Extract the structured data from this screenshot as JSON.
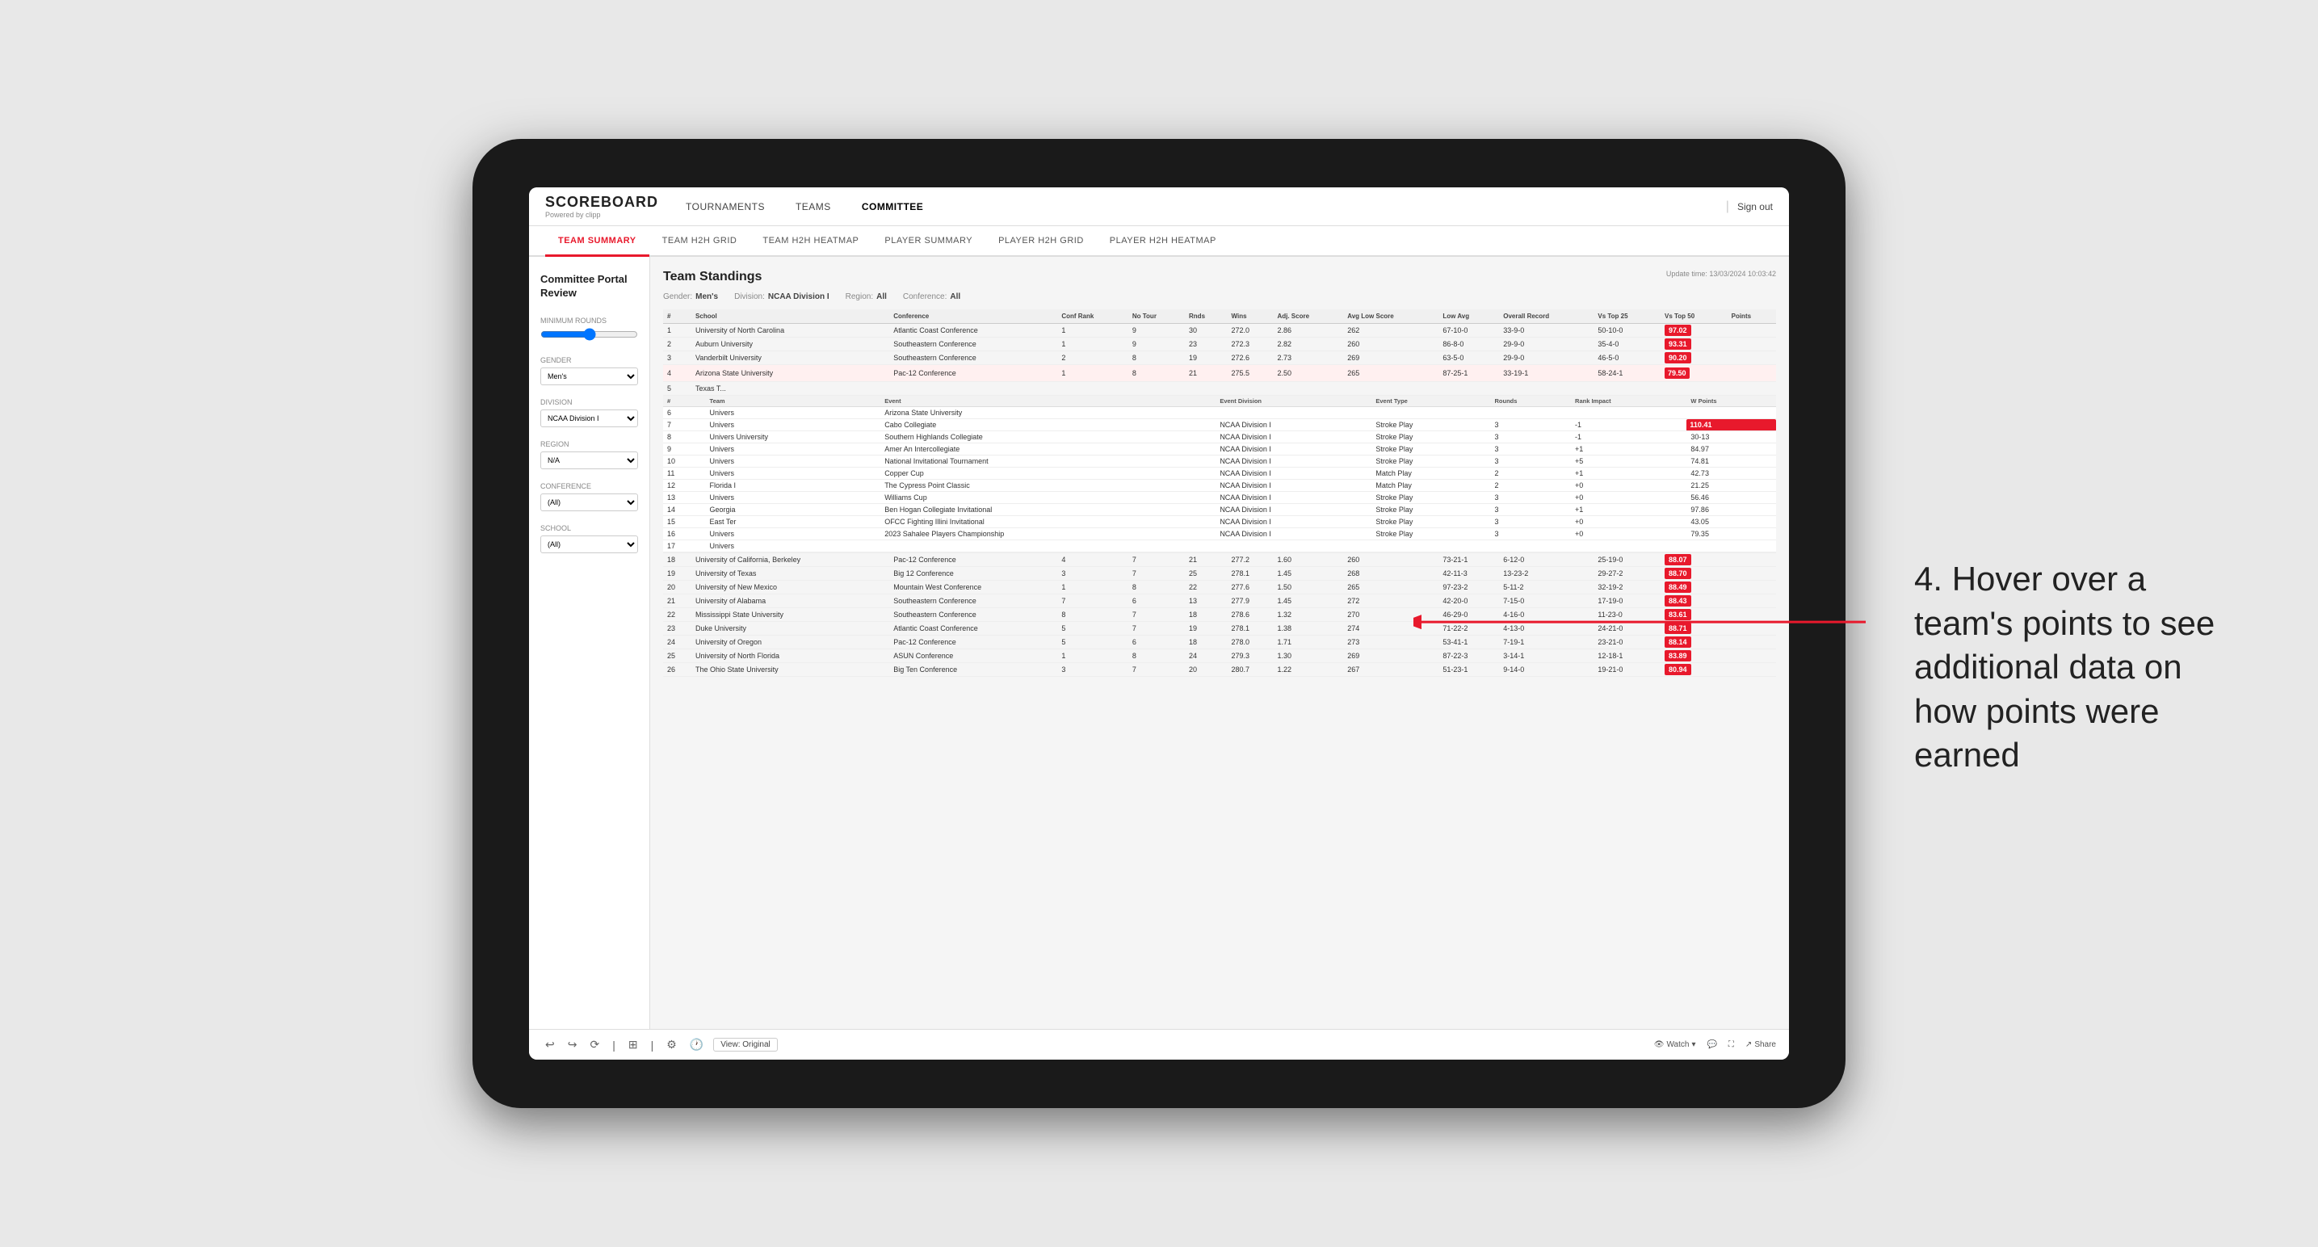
{
  "tablet": {
    "nav": {
      "logo": "SCOREBOARD",
      "powered_by": "Powered by clipp",
      "links": [
        "TOURNAMENTS",
        "TEAMS",
        "COMMITTEE"
      ],
      "sign_out": "Sign out"
    },
    "tabs": [
      {
        "label": "TEAM SUMMARY",
        "active": true
      },
      {
        "label": "TEAM H2H GRID"
      },
      {
        "label": "TEAM H2H HEATMAP"
      },
      {
        "label": "PLAYER SUMMARY"
      },
      {
        "label": "PLAYER H2H GRID"
      },
      {
        "label": "PLAYER H2H HEATMAP"
      }
    ],
    "sidebar": {
      "title": "Committee Portal Review",
      "sections": [
        {
          "label": "Minimum Rounds",
          "type": "range"
        },
        {
          "label": "Gender",
          "type": "select",
          "value": "Men's"
        },
        {
          "label": "Division",
          "type": "select",
          "value": "NCAA Division I"
        },
        {
          "label": "Region",
          "type": "select",
          "value": "N/A"
        },
        {
          "label": "Conference",
          "type": "select",
          "value": "(All)"
        },
        {
          "label": "School",
          "type": "select",
          "value": "(All)"
        }
      ]
    },
    "report": {
      "title": "Team Standings",
      "update_time": "Update time: 13/03/2024 10:03:42",
      "filters": {
        "gender": {
          "label": "Gender:",
          "value": "Men's"
        },
        "division": {
          "label": "Division:",
          "value": "NCAA Division I"
        },
        "region": {
          "label": "Region:",
          "value": "All"
        },
        "conference": {
          "label": "Conference:",
          "value": "All"
        }
      },
      "table_headers": [
        "#",
        "School",
        "Conference",
        "Conf Rank",
        "No Tour",
        "Rnds",
        "Wins",
        "Adj Score",
        "Avg Low Score",
        "Low Avg",
        "Overall Record",
        "Vs Top 25",
        "Vs Top 50",
        "Points"
      ],
      "rows": [
        {
          "rank": 1,
          "school": "University of North Carolina",
          "conference": "Atlantic Coast Conference",
          "conf_rank": 1,
          "no_tour": 9,
          "rnds": 30,
          "wins": 272.0,
          "adj_score": 2.86,
          "avg_low": 262,
          "low_avg": "67-10-0",
          "overall": "33-9-0",
          "vs25": "50-10-0",
          "vs50": "97.02",
          "points": "97.02",
          "highlighted": false
        },
        {
          "rank": 2,
          "school": "Auburn University",
          "conference": "Southeastern Conference",
          "conf_rank": 1,
          "no_tour": 9,
          "rnds": 23,
          "wins": 272.3,
          "adj_score": 2.82,
          "avg_low": 260,
          "low_avg": "86-8-0",
          "overall": "29-9-0",
          "vs25": "35-4-0",
          "vs50": "93.31",
          "points": "93.31",
          "highlighted": false
        },
        {
          "rank": 3,
          "school": "Vanderbilt University",
          "conference": "Southeastern Conference",
          "conf_rank": 2,
          "no_tour": 8,
          "rnds": 19,
          "wins": 272.6,
          "adj_score": 2.73,
          "avg_low": 269,
          "low_avg": "63-5-0",
          "overall": "29-9-0",
          "vs25": "46-5-0",
          "vs50": "90.20",
          "points": "90.20",
          "highlighted": false
        },
        {
          "rank": 4,
          "school": "Arizona State University",
          "conference": "Pac-12 Conference",
          "conf_rank": 1,
          "no_tour": 8,
          "rnds": 21,
          "wins": 275.5,
          "adj_score": 2.5,
          "avg_low": 265,
          "low_avg": "87-25-1",
          "overall": "33-19-1",
          "vs25": "58-24-1",
          "vs50": "79.50",
          "points": "79.50",
          "highlighted": true
        },
        {
          "rank": 5,
          "school": "Texas T...",
          "conference": "—",
          "conf_rank": "—",
          "no_tour": "—",
          "rnds": "—",
          "wins": "—",
          "adj_score": "—",
          "avg_low": "—",
          "low_avg": "—",
          "overall": "—",
          "vs25": "—",
          "vs50": "—",
          "points": "—",
          "highlighted": false
        }
      ],
      "expanded": {
        "team": "Univers",
        "university": "University",
        "headers": [
          "Team",
          "Event",
          "Event Division",
          "Event Type",
          "Rounds",
          "Rank Impact",
          "W Points"
        ],
        "rows": [
          {
            "team": "Univers",
            "event": "Cabo Collegiate",
            "division": "NCAA Division I",
            "type": "Stroke Play",
            "rounds": 3,
            "rank_impact": "-1",
            "w_points": "110.41"
          },
          {
            "team": "Univers",
            "event": "Southern Highlands Collegiate",
            "division": "NCAA Division I",
            "type": "Stroke Play",
            "rounds": 3,
            "rank_impact": "-1",
            "w_points": "30-13"
          },
          {
            "team": "Univers",
            "event": "Amer An Intercollegiate",
            "division": "NCAA Division I",
            "type": "Stroke Play",
            "rounds": 3,
            "rank_impact": "+1",
            "w_points": "84.97"
          },
          {
            "team": "Univers",
            "event": "National Invitational Tournament",
            "division": "NCAA Division I",
            "type": "Stroke Play",
            "rounds": 3,
            "rank_impact": "+5",
            "w_points": "74.81"
          },
          {
            "team": "Univers",
            "event": "Copper Cup",
            "division": "NCAA Division I",
            "type": "Match Play",
            "rounds": 2,
            "rank_impact": "+1",
            "w_points": "42.73"
          },
          {
            "team": "Florida I",
            "event": "The Cypress Point Classic",
            "division": "NCAA Division I",
            "type": "Match Play",
            "rounds": 2,
            "rank_impact": "+0",
            "w_points": "21.25"
          },
          {
            "team": "Univers",
            "event": "Williams Cup",
            "division": "NCAA Division I",
            "type": "Stroke Play",
            "rounds": 3,
            "rank_impact": "+0",
            "w_points": "56.46"
          },
          {
            "team": "Georgia",
            "event": "Ben Hogan Collegiate Invitational",
            "division": "NCAA Division I",
            "type": "Stroke Play",
            "rounds": 3,
            "rank_impact": "+1",
            "w_points": "97.86"
          },
          {
            "team": "East Ter",
            "event": "OFCC Fighting Illini Invitational",
            "division": "NCAA Division I",
            "type": "Stroke Play",
            "rounds": 3,
            "rank_impact": "+0",
            "w_points": "43.05"
          },
          {
            "team": "Univers",
            "event": "2023 Sahalee Players Championship",
            "division": "NCAA Division I",
            "type": "Stroke Play",
            "rounds": 3,
            "rank_impact": "+0",
            "w_points": "79.35"
          }
        ]
      },
      "lower_rows": [
        {
          "rank": 18,
          "school": "University of California, Berkeley",
          "conference": "Pac-12 Conference",
          "conf_rank": 4,
          "no_tour": 7,
          "rnds": 21,
          "wins": 277.2,
          "adj_score": 1.6,
          "avg_low": 260,
          "low_avg": "73-21-1",
          "overall": "6-12-0",
          "vs25": "25-19-0",
          "vs50": "88.07"
        },
        {
          "rank": 19,
          "school": "University of Texas",
          "conference": "Big 12 Conference",
          "conf_rank": 3,
          "no_tour": 7,
          "rnds": 25,
          "wins": 278.1,
          "adj_score": 1.45,
          "avg_low": 268,
          "low_avg": "42-11-3",
          "overall": "13-23-2",
          "vs25": "29-27-2",
          "vs50": "88.70"
        },
        {
          "rank": 20,
          "school": "University of New Mexico",
          "conference": "Mountain West Conference",
          "conf_rank": 1,
          "no_tour": 8,
          "rnds": 22,
          "wins": 277.6,
          "adj_score": 1.5,
          "avg_low": 265,
          "low_avg": "97-23-2",
          "overall": "5-11-2",
          "vs25": "32-19-2",
          "vs50": "88.49"
        },
        {
          "rank": 21,
          "school": "University of Alabama",
          "conference": "Southeastern Conference",
          "conf_rank": 7,
          "no_tour": 6,
          "rnds": 13,
          "wins": 277.9,
          "adj_score": 1.45,
          "avg_low": 272,
          "low_avg": "42-20-0",
          "overall": "7-15-0",
          "vs25": "17-19-0",
          "vs50": "88.43"
        },
        {
          "rank": 22,
          "school": "Mississippi State University",
          "conference": "Southeastern Conference",
          "conf_rank": 8,
          "no_tour": 7,
          "rnds": 18,
          "wins": 278.6,
          "adj_score": 1.32,
          "avg_low": 270,
          "low_avg": "46-29-0",
          "overall": "4-16-0",
          "vs25": "11-23-0",
          "vs50": "83.61"
        },
        {
          "rank": 23,
          "school": "Duke University",
          "conference": "Atlantic Coast Conference",
          "conf_rank": 5,
          "no_tour": 7,
          "rnds": 19,
          "wins": 278.1,
          "adj_score": 1.38,
          "avg_low": 274,
          "low_avg": "71-22-2",
          "overall": "4-13-0",
          "vs25": "24-21-0",
          "vs50": "88.71"
        },
        {
          "rank": 24,
          "school": "University of Oregon",
          "conference": "Pac-12 Conference",
          "conf_rank": 5,
          "no_tour": 6,
          "rnds": 18,
          "wins": 278.0,
          "adj_score": 1.71,
          "avg_low": 273,
          "low_avg": "53-41-1",
          "overall": "7-19-1",
          "vs25": "23-21-0",
          "vs50": "88.14"
        },
        {
          "rank": 25,
          "school": "University of North Florida",
          "conference": "ASUN Conference",
          "conf_rank": 1,
          "no_tour": 8,
          "rnds": 24,
          "wins": 279.3,
          "adj_score": 1.3,
          "avg_low": 269,
          "low_avg": "87-22-3",
          "overall": "3-14-1",
          "vs25": "12-18-1",
          "vs50": "83.89"
        },
        {
          "rank": 26,
          "school": "The Ohio State University",
          "conference": "Big Ten Conference",
          "conf_rank": 3,
          "no_tour": 7,
          "rnds": 20,
          "wins": 280.7,
          "adj_score": 1.22,
          "avg_low": 267,
          "low_avg": "51-23-1",
          "overall": "9-14-0",
          "vs25": "19-21-0",
          "vs50": "80.94"
        }
      ]
    },
    "bottom_bar": {
      "view": "View: Original",
      "watch": "Watch",
      "share": "Share"
    }
  },
  "annotation": {
    "text": "4. Hover over a team's points to see additional data on how points were earned",
    "arrow_color": "#e8192c"
  }
}
